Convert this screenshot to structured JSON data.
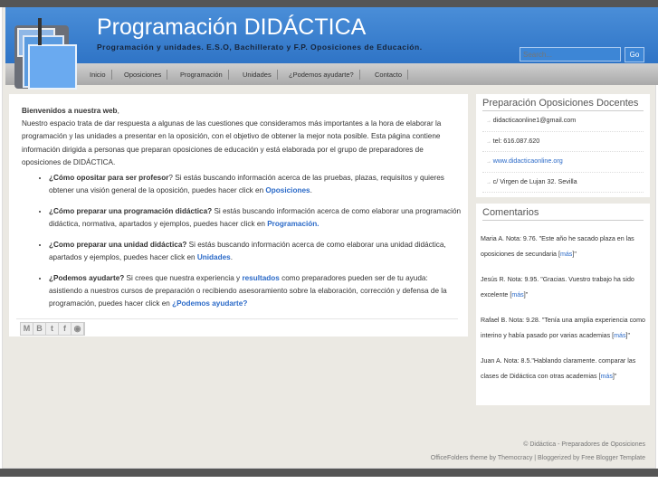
{
  "header": {
    "title": "Programación DIDÁCTICA",
    "tagline": "Programación y unidades. E.S.O, Bachillerato y F.P. Oposiciones de Educación.",
    "search_placeholder": "Search...",
    "go": "Go"
  },
  "nav": [
    "Inicio",
    "Oposiciones",
    "Programación",
    "Unidades",
    "¿Podemos ayudarte?",
    "Contacto"
  ],
  "main": {
    "welcome": "Bienvenidos a nuestra web",
    "intro": "Nuestro espacio trata de dar respuesta a algunas de las cuestiones que consideramos más importantes a la hora de elaborar la programación y las unidades a presentar en la oposición, con el objetivo de obtener la mejor nota posible. Esta página contiene información dirigida a personas que preparan oposiciones de educación y está elaborada por el grupo de preparadores de oposiciones de DIDÁCTICA.",
    "items": [
      {
        "q": "¿Cómo opositar para ser profesor",
        "t1": "? Si estás buscando información acerca de las pruebas, plazas, requisitos y quieres obtener una visión general de la oposición, puedes hacer click en ",
        "link": "Oposiciones",
        "t2": "."
      },
      {
        "q": "¿Cómo preparar una programación didáctica?",
        "t1": " Si estás buscando información acerca de como elaborar una programación didáctica, normativa, apartados y ejemplos, puedes hacer click en ",
        "link": "Programación.",
        "t2": ""
      },
      {
        "q": "¿Como preparar una unidad didáctica?",
        "t1": " Si estás buscando información acerca de como elaborar una unidad didáctica, apartados y ejemplos, puedes hacer click en ",
        "link": "Unidades",
        "t2": "."
      },
      {
        "q": "¿Podemos ayudarte?",
        "t1": " Si crees que nuestra experiencia y ",
        "link0": "resultados",
        "t1b": " como preparadores pueden ser de tu ayuda: asistiendo a nuestros cursos de preparación o recibiendo asesoramiento sobre la elaboración, corrección y defensa de la programación, puedes hacer click en ",
        "link": "¿Podemos ayudarte?",
        "t2": ""
      }
    ]
  },
  "sidebar": {
    "contact_title": "Preparación Oposiciones Docentes",
    "contact": [
      "didacticaonline1@gmail.com",
      "tel: 616.087.620",
      "www.didacticaonline.org",
      "c/ Virgen de Lujan 32. Sevilla"
    ],
    "comments_title": "Comentarios",
    "more": "más",
    "comments": [
      "Maria A. Nota: 9.76. \"Este año he sacado plaza en las oposiciones de secundaria [",
      "Jesús R. Nota: 9.95. \"Gracias. Vuestro trabajo ha sido excelente [",
      "Rafael B. Nota: 9.28. \"Tenía una amplia experiencia como interino y había pasado por varias academias [",
      "Juan A. Nota: 8.5.\"Hablando claramente. comparar las clases de Didáctica con otras academias ["
    ],
    "close": "]\""
  },
  "footer": {
    "line1": "© Didáctica - Preparadores de Oposiciones",
    "line2": "OfficeFolders theme by Themocracy | Bloggerized by Free Blogger Template"
  }
}
